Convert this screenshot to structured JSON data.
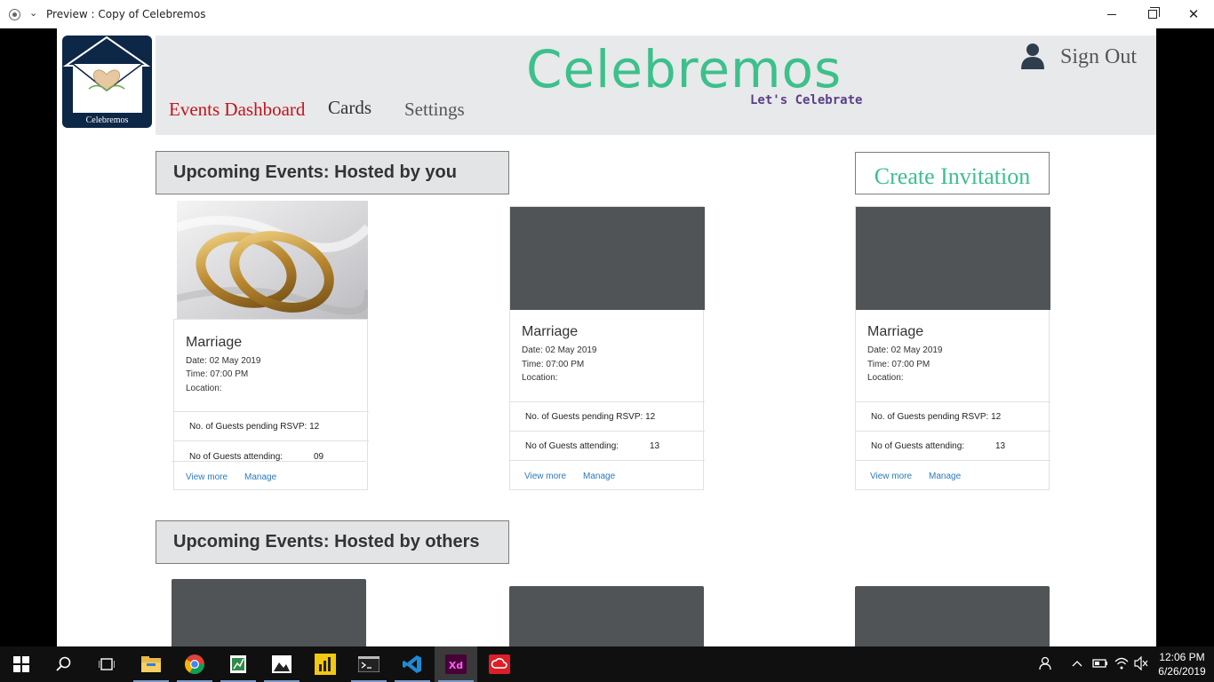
{
  "window": {
    "title": "Preview : Copy of Celebremos",
    "chevron": "⌄",
    "close_glyph": "✕"
  },
  "app": {
    "logo_text": "Celebremos",
    "brand": "Celebremos",
    "tagline": "Let's Celebrate",
    "nav": {
      "events": "Events Dashboard",
      "cards": "Cards",
      "settings": "Settings"
    },
    "signout": "Sign Out",
    "colors": {
      "brand": "#3cc08c",
      "nav_active": "#c0141c",
      "tagline": "#5a3f8a",
      "logo_bg": "#0d2746",
      "card_placeholder": "#505457",
      "link": "#2a7ac0"
    }
  },
  "hosted_by_you": {
    "heading": "Upcoming Events: Hosted by you",
    "create_label": "Create Invitation",
    "cards": [
      {
        "title": "Marriage",
        "date": "Date: 02 May 2019",
        "time": "Time: 07:00 PM",
        "location": "Location:",
        "pending_label": "No. of Guests pending RSVP: 12",
        "attending_label": "No of Guests attending:",
        "attending_value": "09",
        "view_more": "View more",
        "manage": "Manage",
        "image": "wedding-rings-photo"
      },
      {
        "title": "Marriage",
        "date": "Date: 02 May 2019",
        "time": "Time: 07:00 PM",
        "location": "Location:",
        "pending_label": "No. of Guests pending RSVP: 12",
        "attending_label": "No of Guests attending:",
        "attending_value": "13",
        "view_more": "View more",
        "manage": "Manage"
      },
      {
        "title": "Marriage",
        "date": "Date: 02 May 2019",
        "time": "Time: 07:00 PM",
        "location": "Location:",
        "pending_label": "No. of Guests pending RSVP: 12",
        "attending_label": "No of Guests attending:",
        "attending_value": "13",
        "view_more": "View more",
        "manage": "Manage"
      }
    ]
  },
  "hosted_by_others": {
    "heading": "Upcoming Events: Hosted by others"
  },
  "taskbar": {
    "icons": [
      "windows-start-icon",
      "search-icon",
      "task-view-icon",
      "file-explorer-icon",
      "chrome-icon",
      "excel-icon",
      "photos-icon",
      "power-bi-icon",
      "terminal-icon",
      "vscode-icon",
      "adobe-xd-icon",
      "creative-cloud-icon"
    ],
    "active": "adobe-xd-icon",
    "time": "12:06 PM",
    "date": "6/26/2019"
  }
}
